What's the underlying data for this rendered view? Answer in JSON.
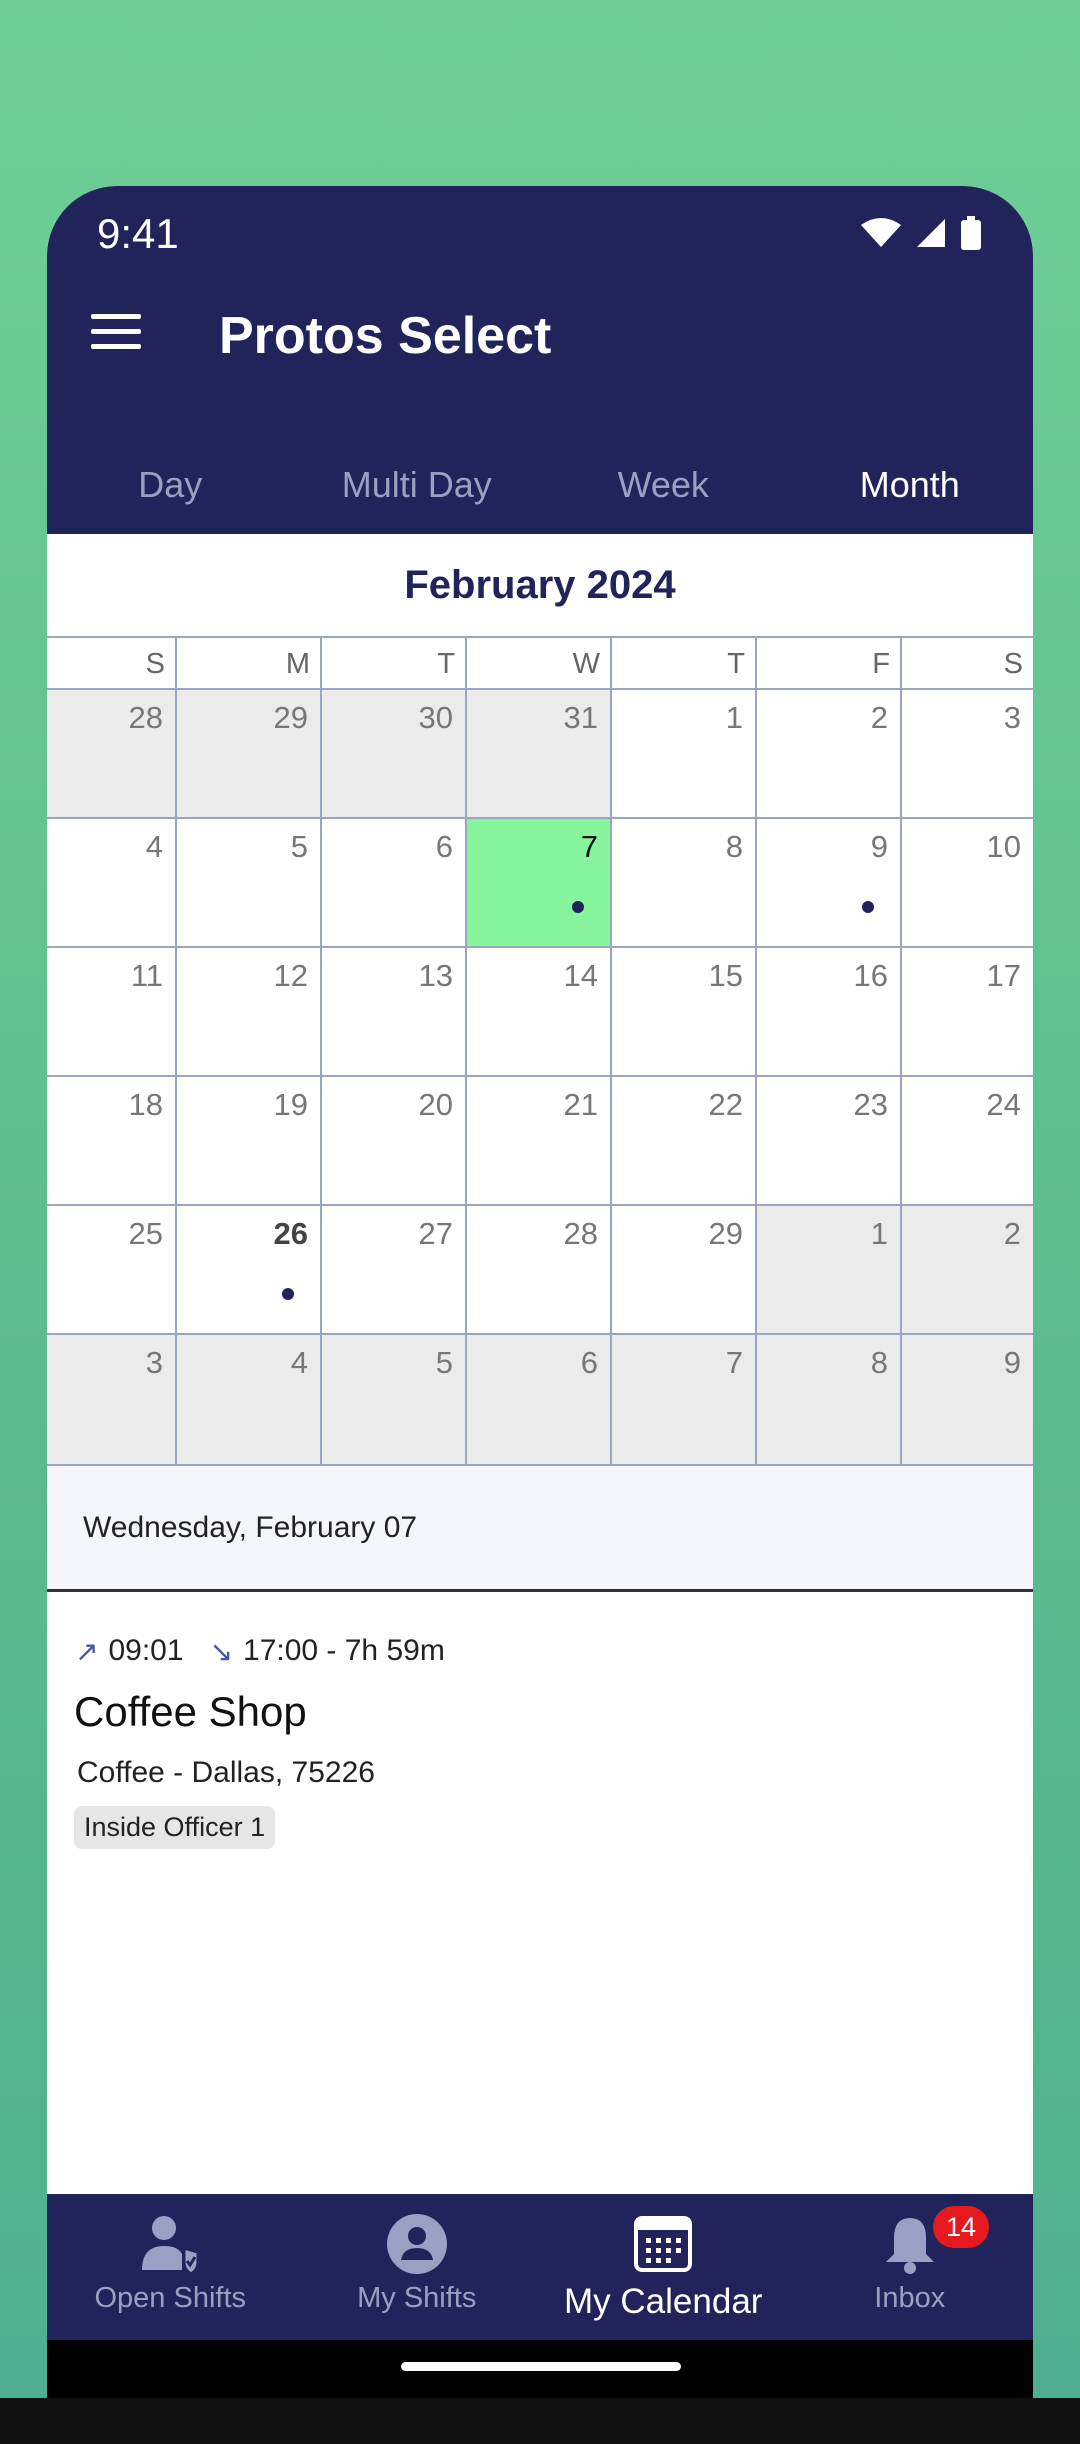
{
  "status_bar": {
    "time": "9:41"
  },
  "app_bar": {
    "title": "Protos Select"
  },
  "view_tabs": [
    "Day",
    "Multi Day",
    "Week",
    "Month"
  ],
  "active_view_tab": "Month",
  "calendar": {
    "month_title": "February 2024",
    "weekdays": [
      "S",
      "M",
      "T",
      "W",
      "T",
      "F",
      "S"
    ],
    "weeks": [
      [
        {
          "d": "28",
          "other": true
        },
        {
          "d": "29",
          "other": true
        },
        {
          "d": "30",
          "other": true
        },
        {
          "d": "31",
          "other": true
        },
        {
          "d": "1"
        },
        {
          "d": "2"
        },
        {
          "d": "3"
        }
      ],
      [
        {
          "d": "4"
        },
        {
          "d": "5"
        },
        {
          "d": "6"
        },
        {
          "d": "7",
          "selected": true,
          "dot": true
        },
        {
          "d": "8"
        },
        {
          "d": "9",
          "dot": true
        },
        {
          "d": "10"
        }
      ],
      [
        {
          "d": "11"
        },
        {
          "d": "12"
        },
        {
          "d": "13"
        },
        {
          "d": "14"
        },
        {
          "d": "15"
        },
        {
          "d": "16"
        },
        {
          "d": "17"
        }
      ],
      [
        {
          "d": "18"
        },
        {
          "d": "19"
        },
        {
          "d": "20"
        },
        {
          "d": "21"
        },
        {
          "d": "22"
        },
        {
          "d": "23"
        },
        {
          "d": "24"
        }
      ],
      [
        {
          "d": "25"
        },
        {
          "d": "26",
          "today": true,
          "dot": true
        },
        {
          "d": "27"
        },
        {
          "d": "28"
        },
        {
          "d": "29"
        },
        {
          "d": "1",
          "other": true
        },
        {
          "d": "2",
          "other": true
        }
      ],
      [
        {
          "d": "3",
          "other": true
        },
        {
          "d": "4",
          "other": true
        },
        {
          "d": "5",
          "other": true
        },
        {
          "d": "6",
          "other": true
        },
        {
          "d": "7",
          "other": true
        },
        {
          "d": "8",
          "other": true
        },
        {
          "d": "9",
          "other": true
        }
      ]
    ]
  },
  "selected_date_label": "Wednesday, February 07",
  "shift": {
    "start": "09:01",
    "end_and_duration": "17:00 - 7h 59m",
    "site": "Coffee Shop",
    "location": "Coffee - Dallas, 75226",
    "role": "Inside Officer 1"
  },
  "bottom_nav": {
    "items": [
      {
        "label": "Open Shifts",
        "icon": "open-shifts-icon"
      },
      {
        "label": "My Shifts",
        "icon": "account-icon"
      },
      {
        "label": "My Calendar",
        "icon": "calendar-icon"
      },
      {
        "label": "Inbox",
        "icon": "bell-icon"
      }
    ],
    "active": "My Calendar",
    "inbox_badge": "14"
  },
  "colors": {
    "brand_navy": "#20245a",
    "selected_day": "#86f59d",
    "badge_red": "#e5191e"
  }
}
